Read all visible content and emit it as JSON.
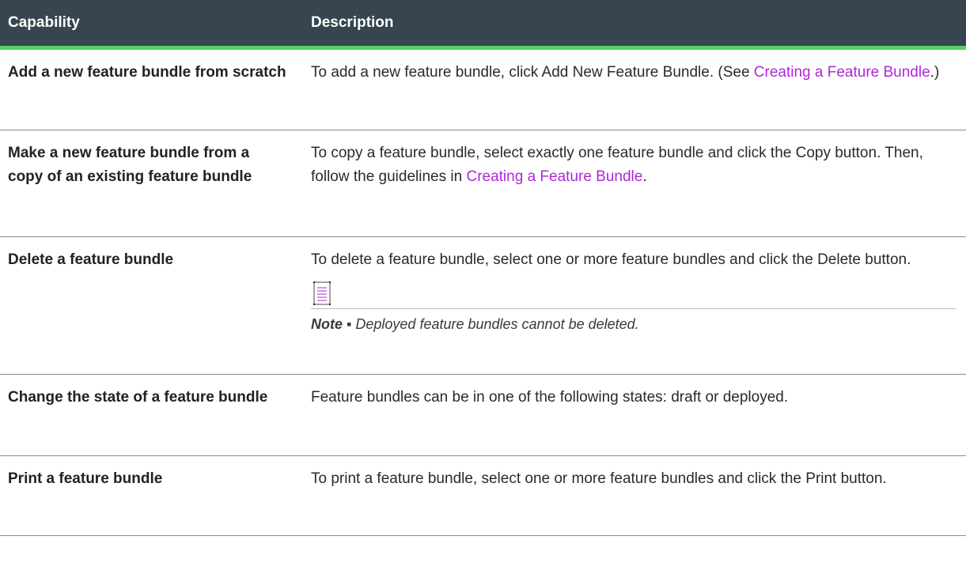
{
  "table": {
    "headers": {
      "capability": "Capability",
      "description": "Description"
    },
    "rows": [
      {
        "capability": "Add a new feature bundle from scratch",
        "desc_pre": "To add a new feature bundle, click Add New Feature Bundle. (See ",
        "desc_link": "Creating a Feature Bundle",
        "desc_post": ".)"
      },
      {
        "capability": "Make a new feature bundle from a copy of an existing feature bundle",
        "desc_pre": "To copy a feature bundle, select exactly one feature bundle and click the Copy button. Then, follow the guidelines in ",
        "desc_link": "Creating a Feature Bundle",
        "desc_post": "."
      },
      {
        "capability": "Delete a feature bundle",
        "desc": "To delete a feature bundle, select one or more feature bundles and click the Delete button.",
        "note_icon": "note-icon",
        "note_label": "Note",
        "note_sep": " ▪ ",
        "note_text": "Deployed feature bundles cannot be deleted."
      },
      {
        "capability": "Change the state of a feature bundle",
        "desc": "Feature bundles can be in one of the following states: draft or deployed."
      },
      {
        "capability": "Print a feature bundle",
        "desc": "To print a feature bundle, select one or more feature bundles and click the Print button."
      }
    ]
  },
  "colors": {
    "header_bg": "#36454f",
    "header_rule": "#4fd36b",
    "link": "#b027d6"
  }
}
